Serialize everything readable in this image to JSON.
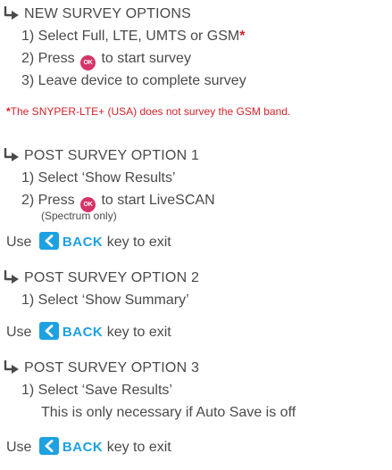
{
  "sections": [
    {
      "heading": "NEW SURVEY OPTIONS",
      "steps": [
        {
          "text": "1) Select Full, LTE, UMTS or GSM",
          "star": "*"
        },
        {
          "before": "2) Press ",
          "after": " to start survey"
        },
        {
          "text": "3) Leave device to complete survey"
        }
      ],
      "note": {
        "star": "*",
        "text": "The SNYPER-LTE+ (USA) does not survey the GSM band."
      }
    },
    {
      "heading": "POST SURVEY OPTION 1",
      "steps": [
        {
          "text": "1) Select ‘Show Results’"
        },
        {
          "before": "2) Press ",
          "after": " to start LiveSCAN"
        }
      ],
      "sub": "(Spectrum only)",
      "use": {
        "before": "Use ",
        "key": "BACK",
        "after": " key to exit"
      }
    },
    {
      "heading": "POST SURVEY OPTION 2",
      "steps": [
        {
          "text": "1) Select ‘Show Summary’"
        }
      ],
      "use": {
        "before": "Use ",
        "key": "BACK",
        "after": " key to exit"
      }
    },
    {
      "heading": "POST SURVEY OPTION 3",
      "steps": [
        {
          "text": "1) Select ‘Save Results’"
        },
        {
          "text": "This is only necessary if Auto Save is off"
        }
      ],
      "use": {
        "before": "Use ",
        "key": "BACK",
        "after": " key to exit"
      }
    }
  ],
  "ok_label": "OK",
  "colors": {
    "text": "#4a4a4a",
    "accent_red": "#d2232a",
    "ok_button": "#d63468",
    "back_blue": "#1ea1e1"
  },
  "icons": {
    "arrow": "return-arrow-icon",
    "ok": "ok-button-icon",
    "back": "back-chevron-icon"
  }
}
